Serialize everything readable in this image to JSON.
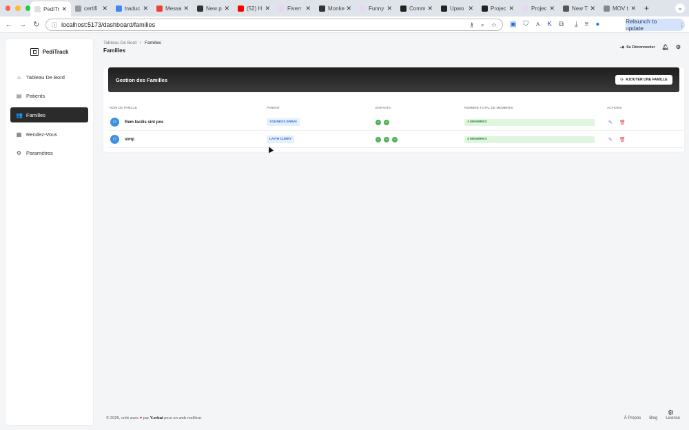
{
  "browser": {
    "tabs": [
      {
        "title": "PediTr",
        "active": true,
        "color": "#e0e0e0"
      },
      {
        "title": "certifi",
        "color": "#999999"
      },
      {
        "title": "traduc",
        "color": "#4285f4"
      },
      {
        "title": "Messa",
        "color": "#ea4335"
      },
      {
        "title": "New p",
        "color": "#333333"
      },
      {
        "title": "(52) H",
        "color": "#ff0000"
      },
      {
        "title": "Fiverr",
        "color": "#e8d7ef"
      },
      {
        "title": "Monke",
        "color": "#333333"
      },
      {
        "title": "Funny",
        "color": "#e8d7ef"
      },
      {
        "title": "Comm",
        "color": "#222222"
      },
      {
        "title": "Upwo",
        "color": "#222222"
      },
      {
        "title": "Projec",
        "color": "#222222"
      },
      {
        "title": "Projec",
        "color": "#e8d7ef"
      },
      {
        "title": "New T",
        "color": "#555555"
      },
      {
        "title": "MOV t",
        "color": "#888888"
      }
    ],
    "url": "localhost:5173/dashboard/families",
    "relaunch_label": "Relaunch to update"
  },
  "sidebar": {
    "brand": "PediTrack",
    "items": [
      {
        "label": "Tableau De Bord",
        "icon": "home-icon",
        "glyph": "⌂"
      },
      {
        "label": "Patients",
        "icon": "id-card-icon",
        "glyph": "▤"
      },
      {
        "label": "Familles",
        "icon": "users-icon",
        "glyph": "👥",
        "active": true
      },
      {
        "label": "Rendez-Vous",
        "icon": "calendar-icon",
        "glyph": "▦"
      },
      {
        "label": "Paramètres",
        "icon": "gear-icon",
        "glyph": "⚙"
      }
    ]
  },
  "header": {
    "breadcrumb_root": "Tableau De Bord",
    "breadcrumb_sep": "/",
    "breadcrumb_current": "Familles",
    "title": "Familles",
    "logout_label": "Se Déconnecter"
  },
  "families": {
    "card_title": "Gestion des Familles",
    "add_label": "AJOUTER UNE FAMILLE",
    "columns": [
      "NOM DE FAMILLE",
      "PARENT",
      "ENFANTS",
      "NOMBRE TOTAL DE MEMBRES",
      "ACTIONS"
    ],
    "rows": [
      {
        "name": "Rem facilis sint pos",
        "parent": "YOUNESS ERBAI",
        "children": 2,
        "members": "3 MEMBRES"
      },
      {
        "name": "simp",
        "parent": "LAITH CURRY",
        "children": 3,
        "members": "4 MEMBRES"
      }
    ]
  },
  "footer": {
    "prefix": "© 2025, créé avec",
    "by": "par",
    "author": "Y.erbai",
    "suffix": "pour un web meilleur.",
    "links": [
      "À Propos",
      "Blog",
      "Licence"
    ]
  }
}
